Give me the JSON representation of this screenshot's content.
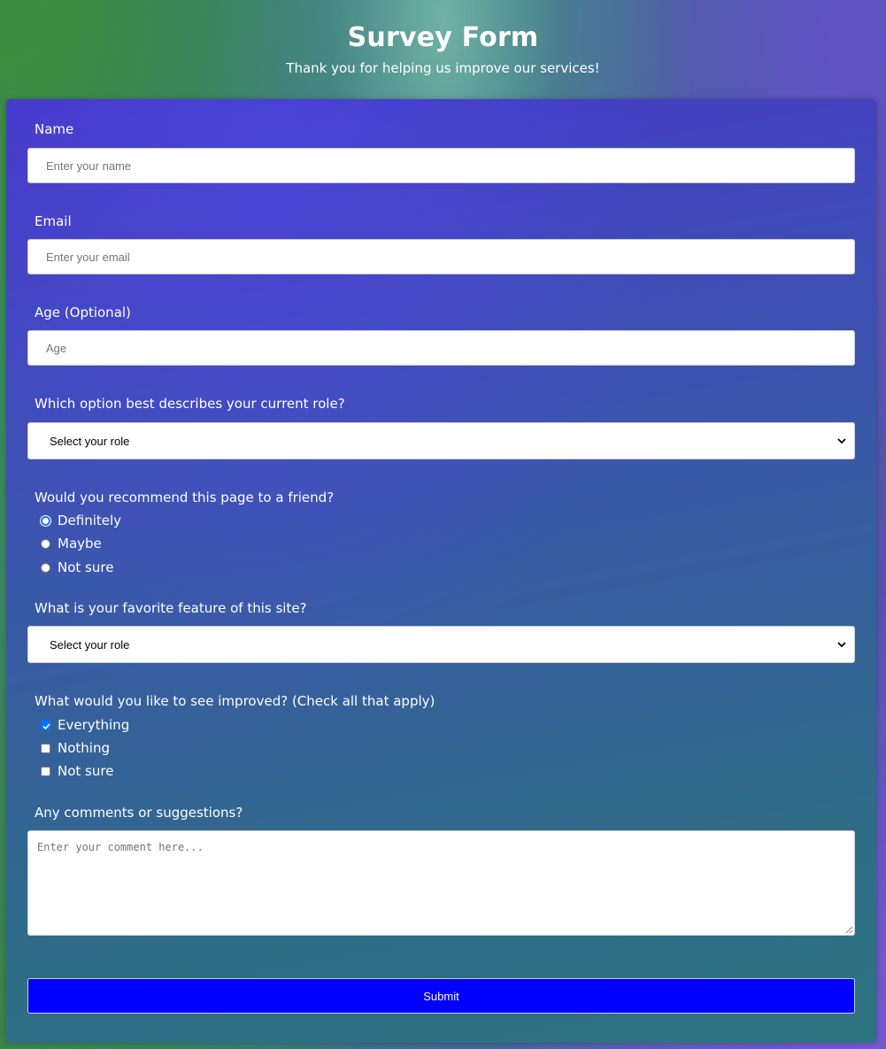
{
  "header": {
    "title": "Survey Form",
    "subtitle": "Thank you for helping us improve our services!"
  },
  "form": {
    "name": {
      "label": "Name",
      "placeholder": "Enter your name",
      "value": ""
    },
    "email": {
      "label": "Email",
      "placeholder": "Enter your email",
      "value": ""
    },
    "age": {
      "label": "Age (Optional)",
      "placeholder": "Age",
      "value": ""
    },
    "role": {
      "label": "Which option best describes your current role?",
      "selected": "Select your role"
    },
    "recommend": {
      "label": "Would you recommend this page to a friend?",
      "options": [
        {
          "label": "Definitely",
          "state": "focused"
        },
        {
          "label": "Maybe",
          "state": "unselected"
        },
        {
          "label": "Not sure",
          "state": "unselected"
        }
      ]
    },
    "favorite": {
      "label": "What is your favorite feature of this site?",
      "selected": "Select your role"
    },
    "improve": {
      "label": "What would you like to see improved? (Check all that apply)",
      "options": [
        {
          "label": "Everything",
          "checked": true
        },
        {
          "label": "Nothing",
          "checked": false
        },
        {
          "label": "Not sure",
          "checked": false
        }
      ]
    },
    "comments": {
      "label": "Any comments or suggestions?",
      "placeholder": "Enter your comment here...",
      "value": ""
    },
    "submit_label": "Submit"
  },
  "colors": {
    "submit_bg": "#0000ff",
    "checkbox_checked": "#0075ff",
    "radio_focus": "#1a73e8",
    "text": "#ffffff"
  },
  "icons": {
    "select_arrow": "chevron-down-icon",
    "checkbox_mark": "check-icon",
    "textarea_resize": "resize-grip-icon"
  }
}
